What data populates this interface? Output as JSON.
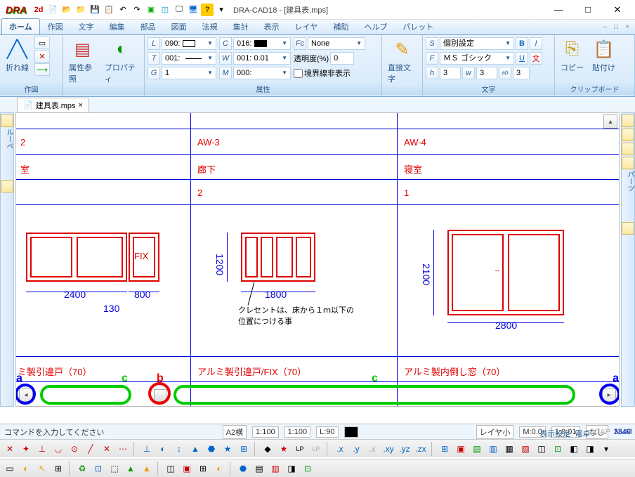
{
  "title": "DRA-CAD18 - [建具表.mps]",
  "qat_icons": [
    "2d3d",
    "file",
    "open",
    "folder",
    "save",
    "doc",
    "undo",
    "redo",
    "view1",
    "view2",
    "win",
    "screen",
    "help"
  ],
  "tabs": [
    "ホーム",
    "作図",
    "文字",
    "編集",
    "部品",
    "図面",
    "法規",
    "集計",
    "表示",
    "レイヤ",
    "補助",
    "ヘルプ",
    "パレット"
  ],
  "active_tab": 0,
  "ribbon": {
    "group1": {
      "label": "作図",
      "btn1": "折れ線"
    },
    "group2": {
      "label": "",
      "btn1": "属性参照",
      "btn2": "プロパティ"
    },
    "group3": {
      "label": "属性",
      "L": "090:",
      "C": "016:",
      "Fc": "None",
      "T": "001:",
      "W": "001: 0.01",
      "trans_label": "透明度(%)",
      "trans_val": "0",
      "G": "1",
      "M": "000:",
      "chk_label": "境界線非表示"
    },
    "group4": {
      "label": "",
      "btn": "直接文字"
    },
    "group5": {
      "label": "文字",
      "S": "個別設定",
      "F": "ＭＳ ゴシック",
      "h": "3",
      "w": "3",
      "r": "3"
    },
    "group6": {
      "label": "クリップボード",
      "btn1": "コピー",
      "btn2": "貼付け"
    }
  },
  "doctab": {
    "name": "建具表.mps"
  },
  "drawing": {
    "row1": {
      "c0": "2",
      "c1": "AW-3",
      "c2": "AW-4"
    },
    "row2": {
      "c0": "室",
      "c1": "廊下",
      "c2": "寝室"
    },
    "row3": {
      "c1": "2",
      "c2": "1"
    },
    "win1": {
      "fix": "FIX",
      "d1": "2400",
      "d2": "800",
      "d3": "130"
    },
    "win2": {
      "h": "1200",
      "w": "1800",
      "note": "クレセントは、床から１ｍ以下の\n位置につける事"
    },
    "win3": {
      "h": "2100",
      "w": "2800"
    },
    "row5": {
      "c0": "ミ製引違戸（70）",
      "c1": "アルミ製引違戸/FIX（70）",
      "c2": "アルミ製内倒し窓（70）"
    }
  },
  "annot": {
    "a": "a",
    "b": "b",
    "c": "c"
  },
  "status": {
    "cmd": "コマンドを入力してください",
    "paper": "A2横",
    "s1": "1:100",
    "s2": "1:100",
    "ang": "L:90",
    "layer": "レイヤ小",
    "mval": "M:0.0",
    "coord": "1:0.01",
    "na": "なし",
    "num": "3346",
    "btns": [
      "表示設定",
      "電卓",
      "CAP",
      "NUM"
    ]
  }
}
